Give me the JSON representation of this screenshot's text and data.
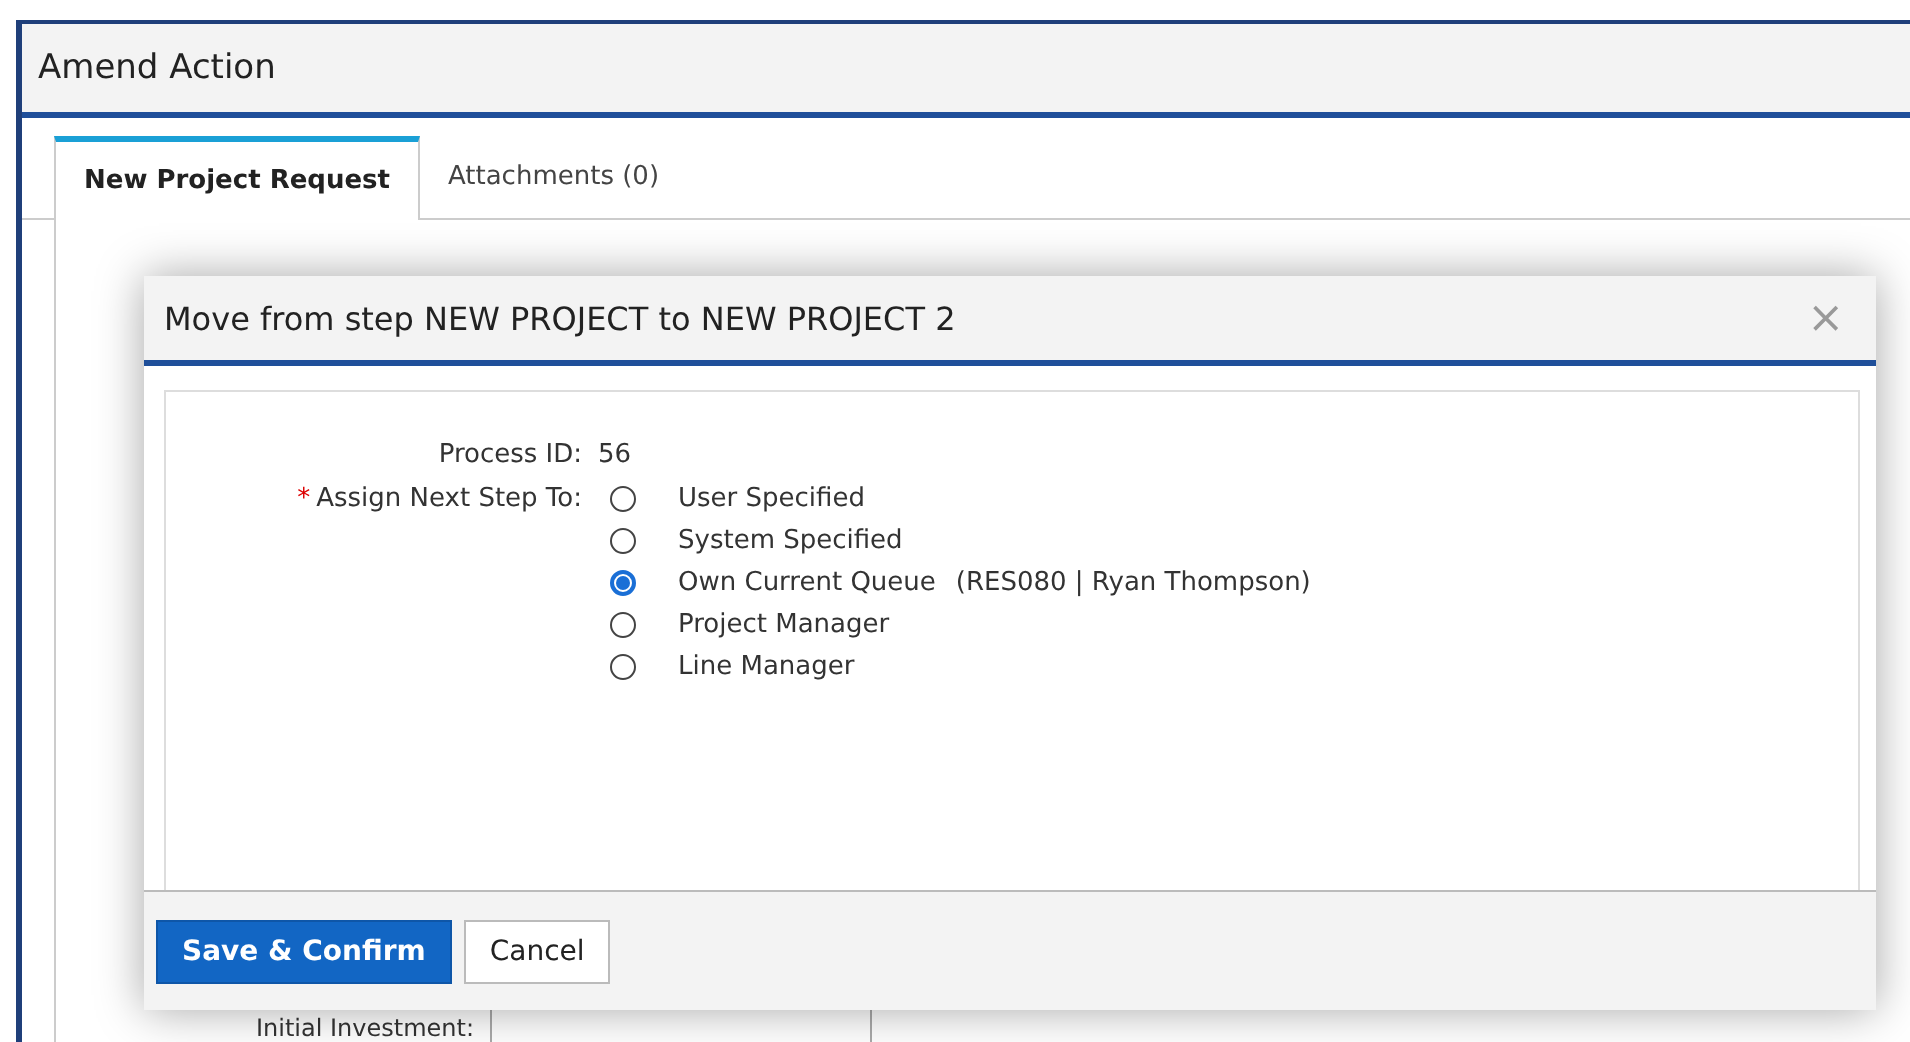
{
  "window": {
    "title": "Amend Action"
  },
  "tabs": [
    {
      "label": "New Project Request",
      "selected": true
    },
    {
      "label": "Attachments (0)",
      "selected": false
    }
  ],
  "background_form": {
    "label": "Initial Investment:"
  },
  "dialog": {
    "title": "Move from step NEW PROJECT to NEW PROJECT 2",
    "close": "×",
    "process_id": {
      "label": "Process ID:",
      "value": "56"
    },
    "assign": {
      "required_mark": "*",
      "label": "Assign Next Step To:",
      "options": [
        {
          "label": "User Specified",
          "selected": false
        },
        {
          "label": "System Specified",
          "selected": false
        },
        {
          "label": "Own Current Queue",
          "detail": "(RES080 | Ryan Thompson)",
          "selected": true
        },
        {
          "label": "Project Manager",
          "selected": false
        },
        {
          "label": "Line Manager",
          "selected": false
        }
      ]
    },
    "buttons": [
      {
        "label": "Save & Confirm",
        "kind": "primary"
      },
      {
        "label": "Cancel",
        "kind": "secondary"
      }
    ]
  }
}
